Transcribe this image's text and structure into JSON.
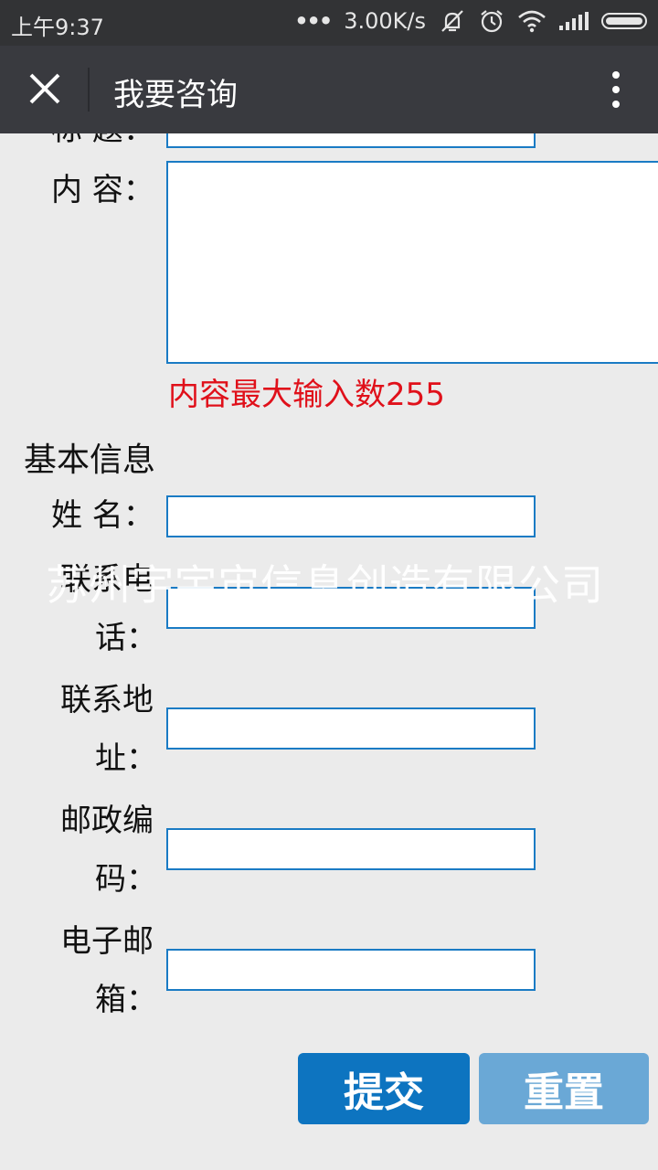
{
  "status_bar": {
    "time": "上午9:37",
    "dots": "•••",
    "network_speed": "3.00K/s",
    "icons": [
      "mute-vibrate-icon",
      "alarm-icon",
      "wifi-icon",
      "signal-icon",
      "battery-icon"
    ]
  },
  "title_bar": {
    "title": "我要咨询",
    "close_icon": "close-icon",
    "more_icon": "more-vertical-icon"
  },
  "form": {
    "subject_label": "标 题：",
    "content_label": "内 容：",
    "content_hint": "内容最大输入数255",
    "section_title": "基本信息",
    "name_label": "姓 名：",
    "phone_label_line1": "联系电",
    "phone_label_line2": "话：",
    "address_label_line1": "联系地",
    "address_label_line2": "址：",
    "postcode_label_line1": "邮政编",
    "postcode_label_line2": "码：",
    "email_label_line1": "电子邮",
    "email_label_line2": "箱：",
    "watermark": "苏州宇宇宙信息创造有限公司",
    "submit_label": "提交",
    "reset_label": "重置"
  },
  "colors": {
    "status_bar_bg": "#323335",
    "title_bar_bg": "#393a3f",
    "page_bg": "#ebebeb",
    "input_border": "#1a7bc4",
    "hint_red": "#e0101a",
    "submit_bg": "#0d74c0",
    "reset_bg": "#6aa8d6"
  }
}
